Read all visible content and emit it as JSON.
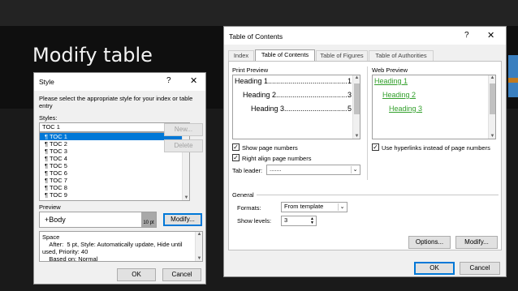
{
  "slide": {
    "title": "Modify table"
  },
  "style_dialog": {
    "title": "Style",
    "help": "?",
    "close": "✕",
    "instruction": "Please select the appropriate style for your index or table entry",
    "styles_label": "Styles:",
    "style_input_value": "TOC 1",
    "items": [
      "TOC 1",
      "TOC 2",
      "TOC 3",
      "TOC 4",
      "TOC 5",
      "TOC 6",
      "TOC 7",
      "TOC 8",
      "TOC 9"
    ],
    "new_label": "New...",
    "delete_label": "Delete",
    "preview_label": "Preview",
    "preview_font": "+Body",
    "preview_size": "10 pt",
    "modify_label": "Modify...",
    "description": "Space\n    After:  5 pt, Style: Automatically update, Hide until used, Priority: 40\n    Based on: Normal",
    "ok_label": "OK",
    "cancel_label": "Cancel"
  },
  "toc_dialog": {
    "title": "Table of Contents",
    "help": "?",
    "close": "✕",
    "tabs": [
      "Index",
      "Table of Contents",
      "Table of Figures",
      "Table of Authorities"
    ],
    "active_tab": 1,
    "print_preview_label": "Print Preview",
    "print_preview": [
      {
        "text": "Heading 1",
        "page": "1"
      },
      {
        "text": "Heading 2",
        "page": "3"
      },
      {
        "text": "Heading 3",
        "page": "5"
      }
    ],
    "web_preview_label": "Web Preview",
    "web_preview": [
      "Heading 1",
      "Heading 2",
      "Heading 3"
    ],
    "show_page_numbers": "Show page numbers",
    "right_align": "Right align page numbers",
    "use_hyperlinks": "Use hyperlinks instead of page numbers",
    "tab_leader_label": "Tab leader:",
    "tab_leader_value": ".......",
    "general_label": "General",
    "formats_label": "Formats:",
    "formats_value": "From template",
    "show_levels_label": "Show levels:",
    "show_levels_value": "3",
    "options_label": "Options...",
    "modify_label": "Modify...",
    "ok_label": "OK",
    "cancel_label": "Cancel"
  },
  "colors": {
    "accent_blue": "#0078d7",
    "hyperlink_green": "#33a02c",
    "slide_bg": "#1a1a1a"
  }
}
